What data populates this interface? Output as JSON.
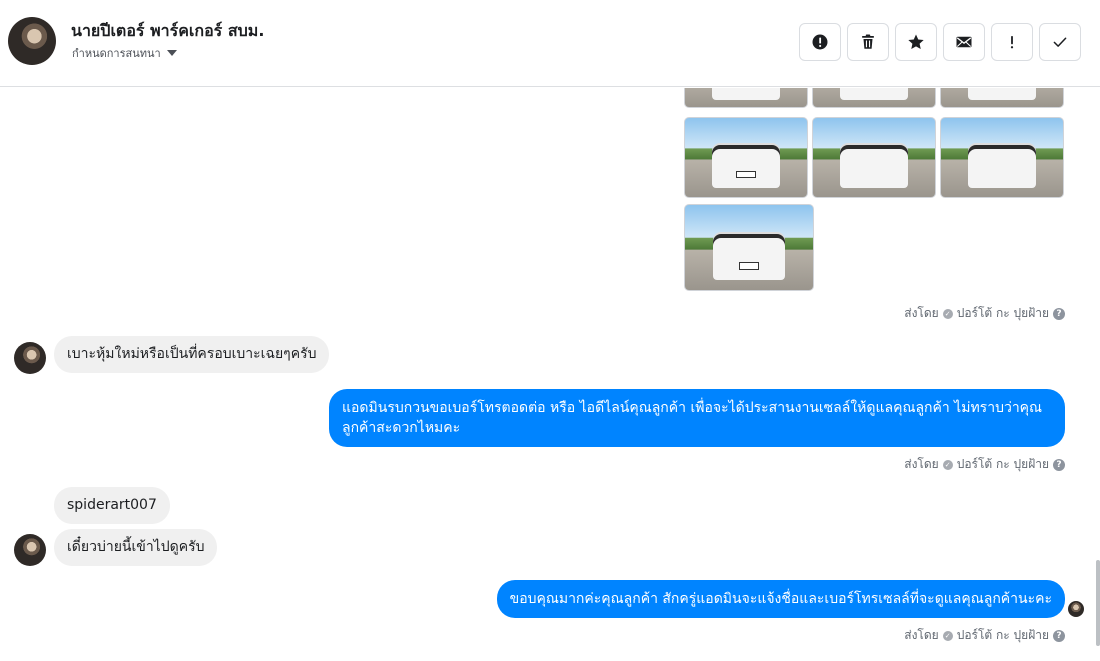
{
  "header": {
    "contact_name": "นายปีเตอร์ พาร์คเกอร์ สบม.",
    "assign_label": "กำหนดการสนทนา",
    "actions": [
      {
        "name": "report-button",
        "icon": "alert-circle-icon"
      },
      {
        "name": "delete-button",
        "icon": "trash-icon"
      },
      {
        "name": "star-button",
        "icon": "star-icon"
      },
      {
        "name": "mark-unread-button",
        "icon": "envelope-icon"
      },
      {
        "name": "mark-important-button",
        "icon": "exclamation-icon"
      },
      {
        "name": "done-button",
        "icon": "check-icon"
      }
    ]
  },
  "thread": {
    "sent_by_label": "ส่งโดย",
    "agent_name": "ปอร์โต้ กะ ปุยฝ้าย",
    "messages": [
      {
        "from": "customer",
        "text": "เบาะหุ้มใหม่หรือเป็นที่ครอบเบาะเฉยๆครับ"
      },
      {
        "from": "page",
        "text": "แอดมินรบกวนขอเบอร์โทรตอดต่อ หรือ ไอดีไลน์คุณลูกค้า เพื่อจะได้ประสานงานเซลล์ให้ดูแลคุณลูกค้า ไม่ทราบว่าคุณลูกค้าสะดวกไหมคะ"
      },
      {
        "from": "customer",
        "text": "spiderart007"
      },
      {
        "from": "customer",
        "text": "เดี๋ยวบ่ายนี้เข้าไปดูครับ"
      },
      {
        "from": "page",
        "text": "ขอบคุณมากค่ะคุณลูกค้า สักครู่แอดมินจะแจ้งชื่อและเบอร์โทรเซลล์ที่จะดูแลคุณลูกค้านะคะ"
      }
    ]
  }
}
